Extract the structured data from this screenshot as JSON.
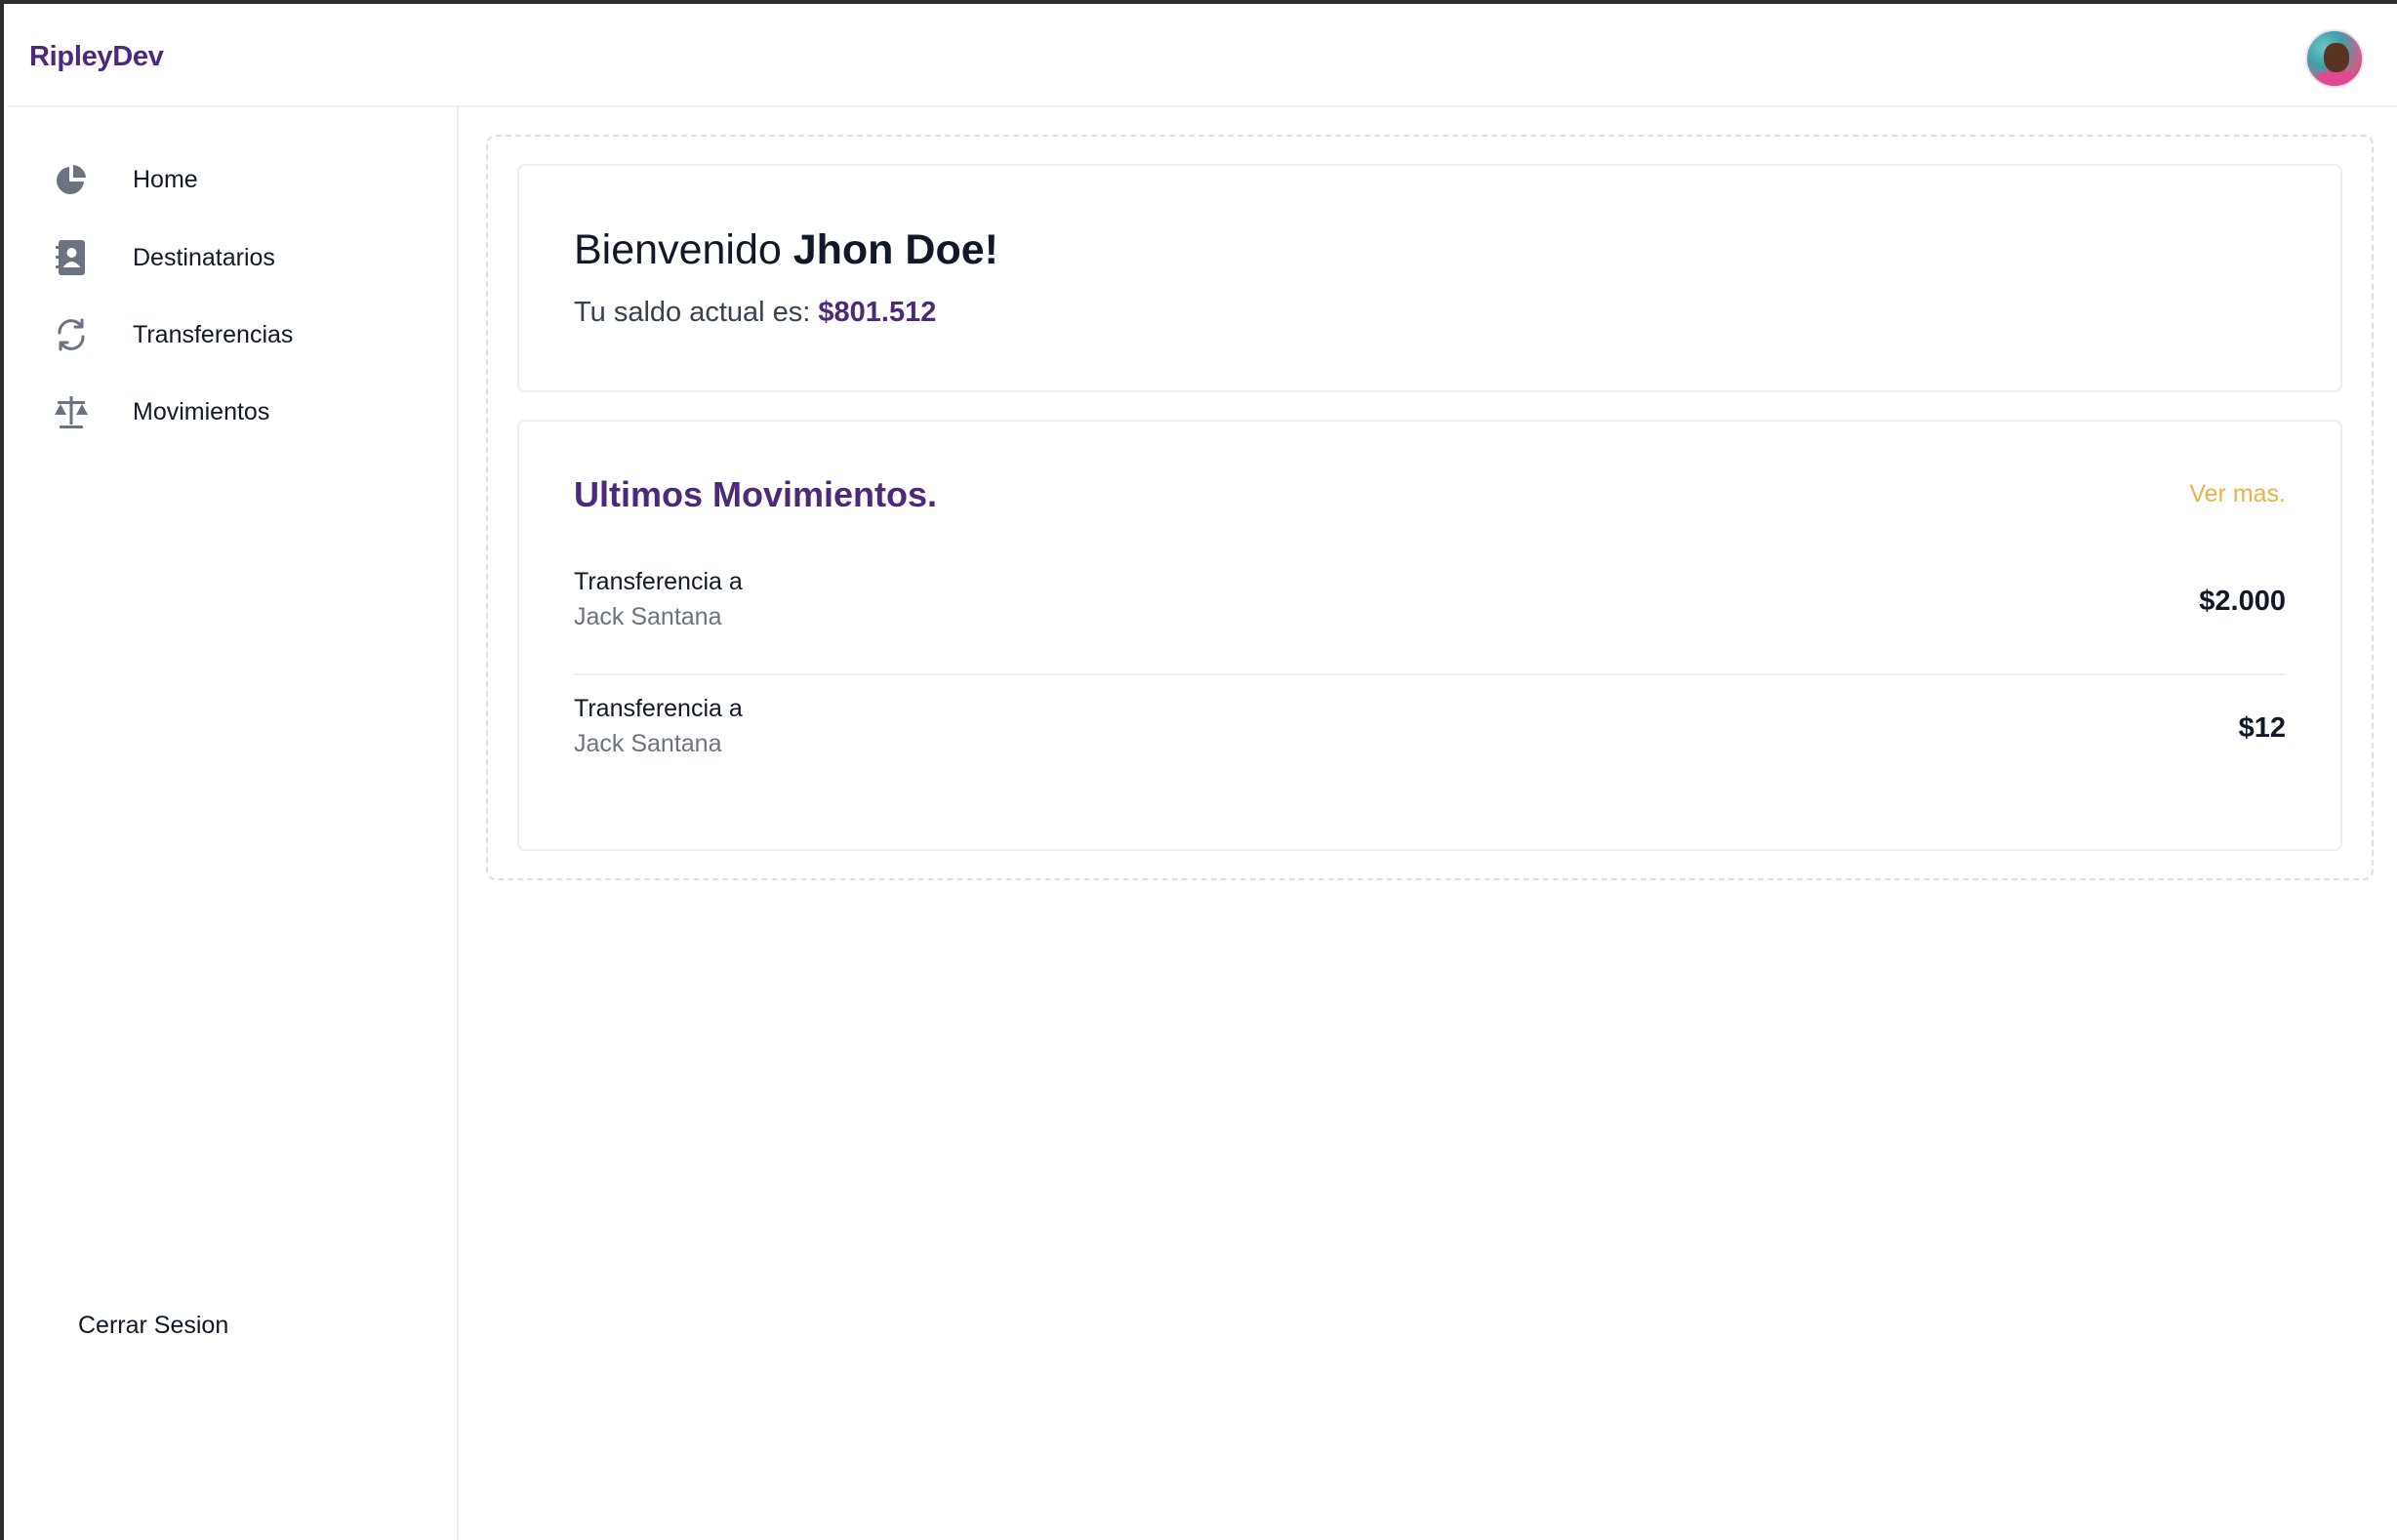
{
  "app": {
    "brand": "RipleyDev"
  },
  "sidebar": {
    "items": [
      {
        "label": "Home",
        "icon": "pie-chart-icon"
      },
      {
        "label": "Destinatarios",
        "icon": "address-book-icon"
      },
      {
        "label": "Transferencias",
        "icon": "refresh-icon"
      },
      {
        "label": "Movimientos",
        "icon": "scale-icon"
      }
    ],
    "logout_label": "Cerrar Sesion"
  },
  "welcome": {
    "greeting": "Bienvenido",
    "user_name": "Jhon Doe!",
    "balance_label": "Tu saldo actual es:",
    "balance_value": "$801.512"
  },
  "movements": {
    "title": "Ultimos Movimientos.",
    "see_more": "Ver mas.",
    "items": [
      {
        "type": "Transferencia a",
        "recipient": "Jack Santana",
        "amount": "$2.000"
      },
      {
        "type": "Transferencia a",
        "recipient": "Jack Santana",
        "amount": "$12"
      }
    ]
  },
  "colors": {
    "brand": "#4c2a78",
    "accent_link": "#e7b34a",
    "icon": "#6b7280"
  }
}
